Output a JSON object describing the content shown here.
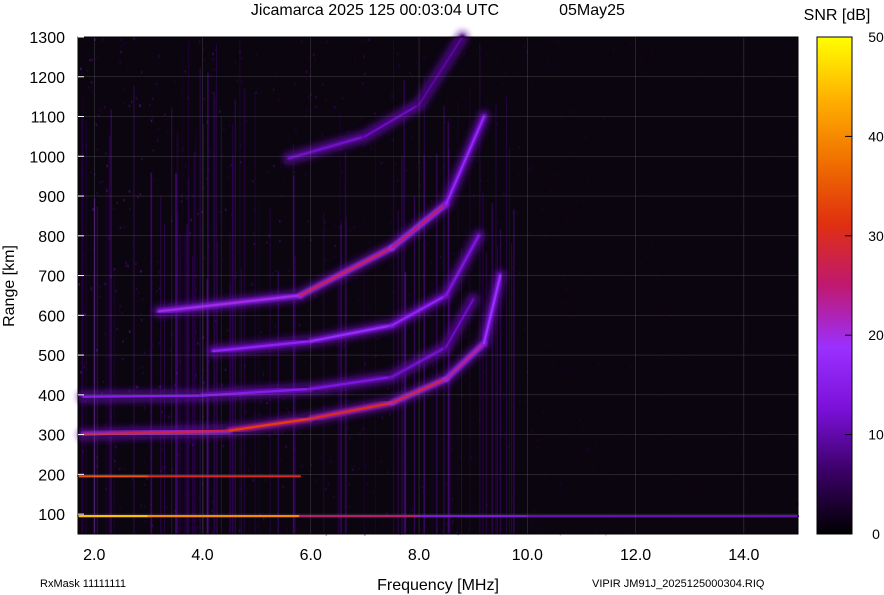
{
  "header": {
    "title": "Jicamarca 2025 125 00:03:04 UTC",
    "date": "05May25"
  },
  "footer": {
    "rxmask": "RxMask 11111111",
    "file": "VIPIR  JM91J_2025125000304.RIQ"
  },
  "colorbar": {
    "label": "SNR [dB]",
    "ticks": [
      "50",
      "40",
      "30",
      "20",
      "10",
      "0"
    ],
    "range": [
      0,
      50
    ],
    "colors": [
      "#000000",
      "#3a0066",
      "#7a10d8",
      "#9b30ff",
      "#c01870",
      "#e03010",
      "#f07000",
      "#ffb000",
      "#ffff00"
    ]
  },
  "chart_data": {
    "type": "heatmap",
    "title": "Jicamarca 2025 125 00:03:04 UTC",
    "xlabel": "Frequency [MHz]",
    "ylabel": "Range [km]",
    "xlim": [
      1.7,
      15.0
    ],
    "ylim": [
      50,
      1300
    ],
    "x_ticks": [
      "2.0",
      "4.0",
      "6.0",
      "8.0",
      "10.0",
      "12.0",
      "14.0"
    ],
    "y_ticks": [
      "100",
      "200",
      "300",
      "400",
      "500",
      "600",
      "700",
      "800",
      "900",
      "1000",
      "1100",
      "1200",
      "1300"
    ],
    "grid": true,
    "colorbar_label": "SNR [dB]",
    "traces": [
      {
        "x": [
          1.7,
          3.0,
          5.8,
          8.0,
          10.0,
          15.0
        ],
        "y": [
          95,
          95,
          95,
          95,
          95,
          95
        ],
        "snr": [
          45,
          45,
          35,
          15,
          12,
          10
        ]
      },
      {
        "x": [
          1.7,
          3.0,
          5.8
        ],
        "y": [
          195,
          195,
          195
        ],
        "snr": [
          35,
          35,
          25
        ]
      },
      {
        "x": [
          1.8,
          4.5,
          6.0,
          7.5,
          8.5,
          9.2,
          9.5
        ],
        "y": [
          300,
          310,
          340,
          380,
          440,
          530,
          700
        ],
        "snr": [
          20,
          35,
          30,
          30,
          25,
          22,
          15
        ]
      },
      {
        "x": [
          1.8,
          4.0,
          6.0,
          7.5,
          8.5,
          9.0
        ],
        "y": [
          395,
          398,
          415,
          445,
          520,
          640
        ],
        "snr": [
          15,
          15,
          15,
          12,
          12,
          10
        ]
      },
      {
        "x": [
          4.2,
          6.0,
          7.5,
          8.5,
          9.1
        ],
        "y": [
          510,
          535,
          575,
          650,
          800
        ],
        "snr": [
          15,
          18,
          18,
          15,
          12
        ]
      },
      {
        "x": [
          3.2,
          5.8,
          7.5,
          8.5,
          9.2
        ],
        "y": [
          610,
          650,
          770,
          880,
          1100
        ],
        "snr": [
          15,
          25,
          28,
          22,
          12
        ]
      },
      {
        "x": [
          5.6,
          7.0,
          8.0,
          8.8
        ],
        "y": [
          995,
          1050,
          1130,
          1300
        ],
        "snr": [
          12,
          12,
          10,
          8
        ]
      }
    ]
  }
}
